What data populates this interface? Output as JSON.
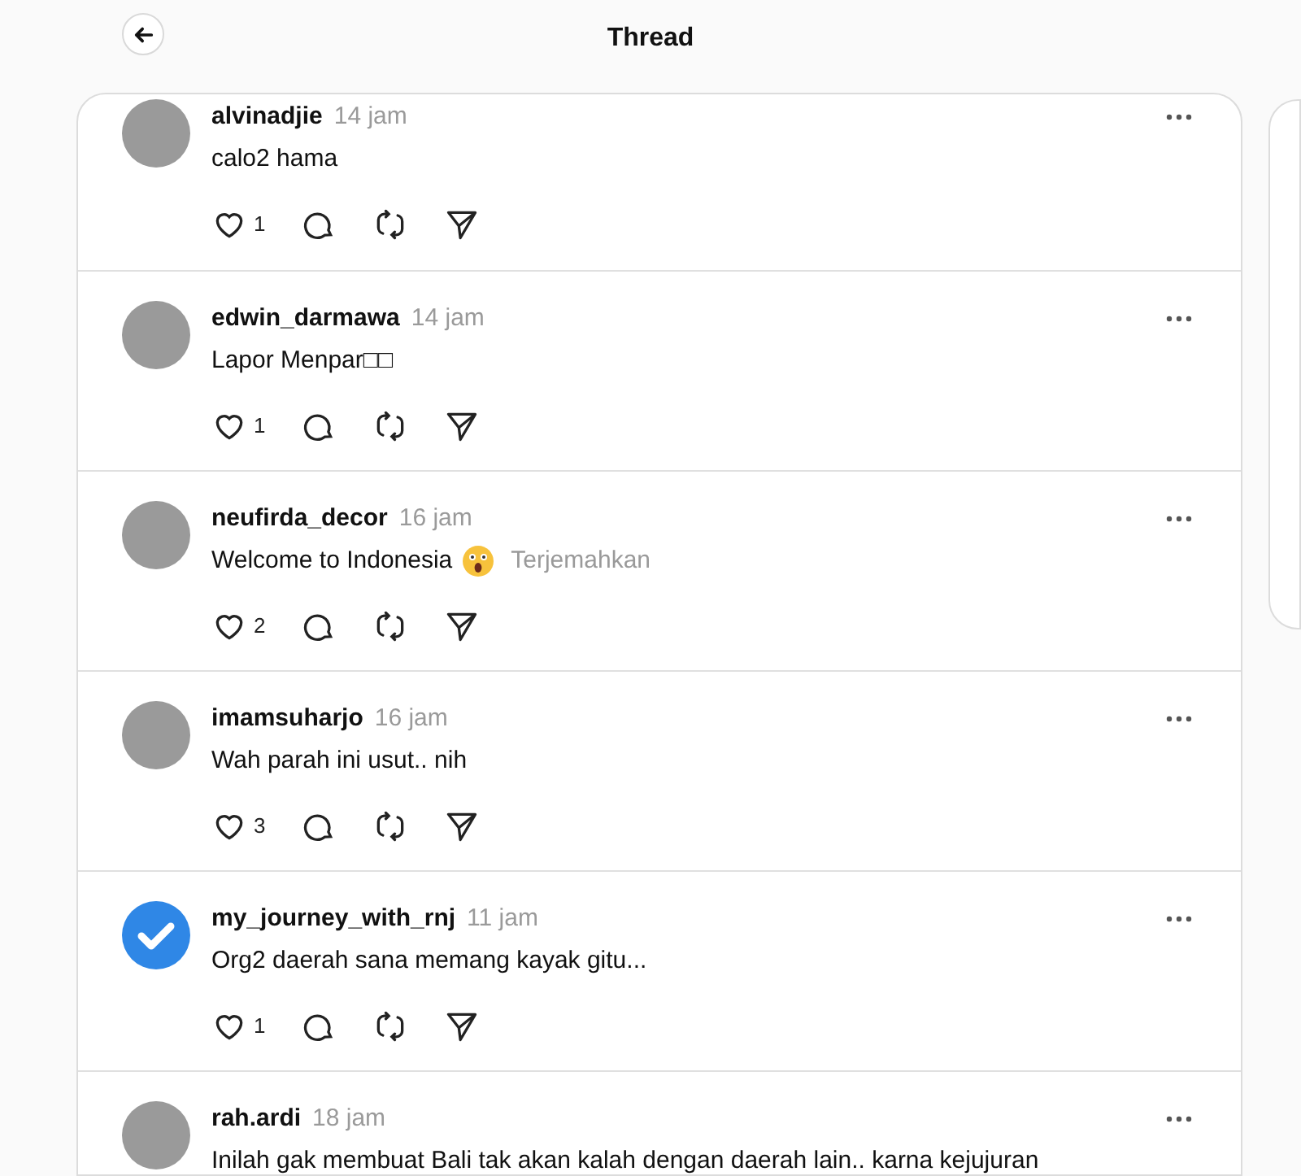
{
  "header": {
    "title": "Thread"
  },
  "replies": [
    {
      "username": "alvinadjie",
      "time": "14 jam",
      "text": "calo2 hama",
      "kind": "photo",
      "likes": "1",
      "actions": true
    },
    {
      "username": "edwin_darmawa",
      "time": "14 jam",
      "text": "Lapor Menpar□□",
      "kind": "photo",
      "likes": "1",
      "actions": true
    },
    {
      "username": "neufirda_decor",
      "time": "16 jam",
      "text": "Welcome to Indonesia",
      "kind": "photo",
      "likes": "2",
      "translate": "Terjemahkan",
      "emoji": true,
      "actions": true
    },
    {
      "username": "imamsuharjo",
      "time": "16 jam",
      "text": "Wah parah ini usut.. nih",
      "kind": "photo",
      "likes": "3",
      "actions": true
    },
    {
      "username": "my_journey_with_rnj",
      "time": "11 jam",
      "text": "Org2 daerah sana memang kayak gitu...",
      "kind": "verified",
      "likes": "1",
      "actions": true
    },
    {
      "username": "rah.ardi",
      "time": "18 jam",
      "text": "Inilah gak membuat Bali tak akan kalah dengan daerah lain.. karna kejujuran",
      "kind": "photo"
    }
  ]
}
